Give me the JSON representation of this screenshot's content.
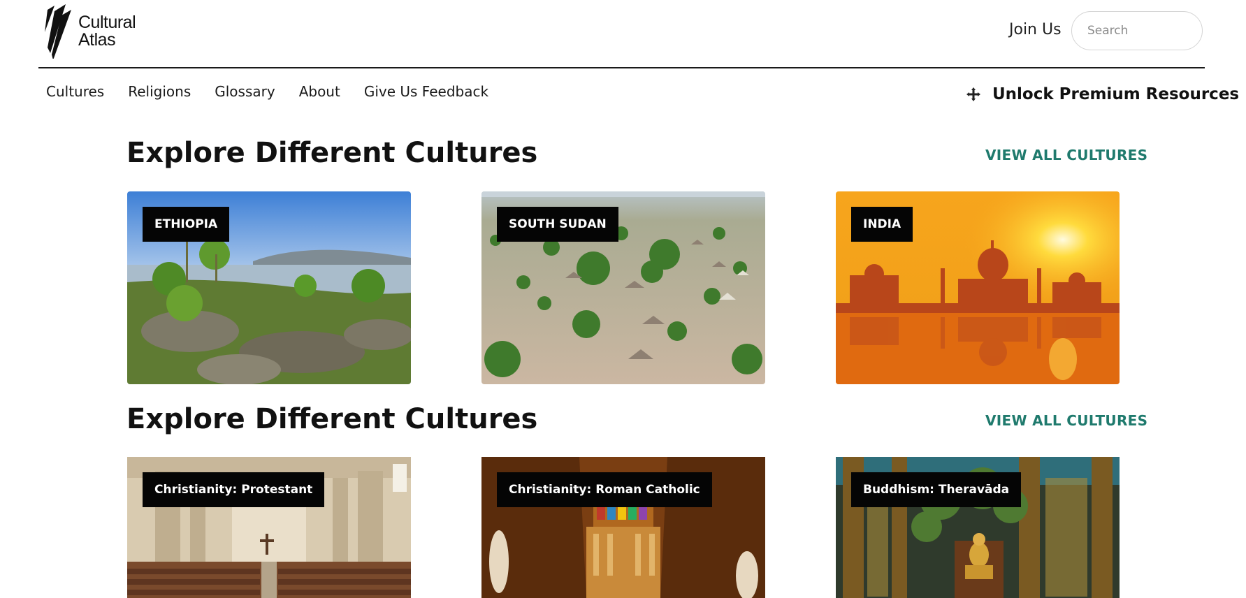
{
  "header": {
    "logo_line1": "Cultural",
    "logo_line2": "Atlas",
    "join_label": "Join Us",
    "search_placeholder": "Search"
  },
  "nav": {
    "items": [
      "Cultures",
      "Religions",
      "Glossary",
      "About",
      "Give Us Feedback"
    ],
    "premium_label": "Unlock Premium Resources",
    "premium_icon": "move-arrows-icon"
  },
  "sections": [
    {
      "title": "Explore Different Cultures",
      "view_all": "VIEW ALL CULTURES",
      "cards": [
        {
          "label": "ETHIOPIA"
        },
        {
          "label": "SOUTH SUDAN"
        },
        {
          "label": "INDIA"
        }
      ]
    },
    {
      "title": "Explore Different Cultures",
      "view_all": "VIEW ALL CULTURES",
      "cards": [
        {
          "label": "Christianity: Protestant"
        },
        {
          "label": "Christianity: Roman Catholic"
        },
        {
          "label": "Buddhism: Theravāda"
        }
      ]
    }
  ],
  "colors": {
    "accent": "#1f7a6d",
    "tag_bg": "#050505",
    "divider": "#1a1a1a"
  }
}
